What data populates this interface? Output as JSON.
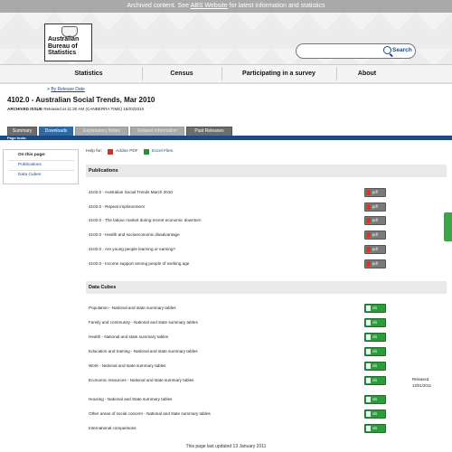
{
  "banner": {
    "prefix": "Archived content. See ",
    "link": "ABS Website",
    "suffix": " for latest information and statistics"
  },
  "logo": {
    "line1": "Australian",
    "line2": "Bureau of",
    "line3": "Statistics"
  },
  "search": {
    "placeholder": "",
    "button_label": "Search"
  },
  "nav": [
    "Statistics",
    "Census",
    "Participating in a survey",
    "About"
  ],
  "breadcrumb": {
    "arrow": ">",
    "link": "By Release Date"
  },
  "page": {
    "title": "4102.0 - Australian Social Trends, Mar 2010",
    "archived_label": "ARCHIVED ISSUE",
    "release_info": " Released at 11:30 AM (CANBERRA TIME) 16/03/2010"
  },
  "tabs": [
    "Summary",
    "Downloads",
    "Explanatory Notes",
    "Related Information",
    "Past Releases"
  ],
  "tools_label": "Page tools:",
  "on_this_page": {
    "title": "On this page:",
    "links": [
      "Publications",
      "Data Cubes"
    ]
  },
  "help": {
    "label": "Help for:",
    "pdf": "Adobe PDF",
    "excel": "Excel Files."
  },
  "publications": {
    "title": "Publications",
    "items": [
      "4102.0 - Australian Social Trends March 2010",
      "4102.0 - Repeat imprisonment",
      "4102.0 - The labour market during recent economic downturn",
      "4102.0 - Health and socioeconomic disadvantage",
      "4102.0 - Are young people learning or earning?",
      "4102.0 - Income support among people of working age"
    ],
    "button_label": "pdf"
  },
  "datacubes": {
    "title": "Data Cubes",
    "items": [
      "Population - National and state summary tables",
      "Family and community - National and state summary tables",
      "Health - National and state summary tables",
      "Education and training - National and state summary tables",
      "Work - National and state summary tables",
      "Economic resources - National and state summary tables",
      "Housing - National and State summary tables",
      "Other areas of social concern - National and state summary tables",
      "International comparisons"
    ],
    "button_label": "xls",
    "released_label": "Released",
    "released_date": "13/01/2011"
  },
  "footer": "This page last updated 13 January 2011",
  "colors": {
    "brand": "#1b4a82",
    "active_tab": "#2f6aa5",
    "excel_green": "#2e9a3e",
    "pdf_red": "#d13b2b"
  }
}
